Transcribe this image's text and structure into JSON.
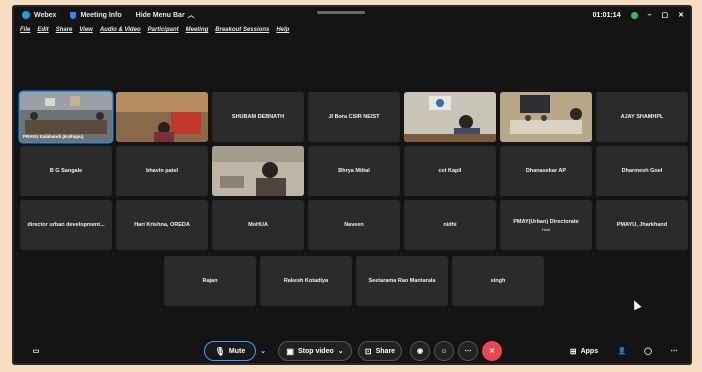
{
  "titlebar": {
    "app_name": "Webex",
    "meeting_info": "Meeting Info",
    "hide_menu_bar": "Hide Menu Bar",
    "timer": "01:01:14"
  },
  "menu": [
    "File",
    "Edit",
    "Share",
    "View",
    "Audio & Video",
    "Participant",
    "Meeting",
    "Breakout Sessions",
    "Help"
  ],
  "participants_row1": [
    {
      "name": "PRAVU Kalahandi (Kolhapu)",
      "video": true,
      "active": true
    },
    {
      "name": "",
      "video": true
    },
    {
      "name": "SHUBAM DEBNATH",
      "video": false
    },
    {
      "name": "JI Bora CSIR NEIST",
      "video": false
    },
    {
      "name": "",
      "video": true
    },
    {
      "name": "",
      "video": true
    },
    {
      "name": "AJAY SHAMHPL",
      "video": false
    }
  ],
  "participants_row2": [
    {
      "name": "B G Sangale",
      "video": false
    },
    {
      "name": "bhavin patel",
      "video": false
    },
    {
      "name": "",
      "video": true
    },
    {
      "name": "Bhrya Mittal",
      "video": false
    },
    {
      "name": "cet Kapil",
      "video": false
    },
    {
      "name": "Dhanasekar AP",
      "video": false
    },
    {
      "name": "Dharmesh Goel",
      "video": false
    }
  ],
  "participants_row3": [
    {
      "name": "director urban development...",
      "sub": "",
      "video": false
    },
    {
      "name": "Hari Krishna, OREDA",
      "sub": "",
      "video": false
    },
    {
      "name": "MoHUA",
      "sub": "",
      "video": false
    },
    {
      "name": "Naveen",
      "sub": "",
      "video": false
    },
    {
      "name": "nidhi",
      "sub": "",
      "video": false
    },
    {
      "name": "PMAY(Urban) Directorate",
      "sub": "Host",
      "video": false
    },
    {
      "name": "PMAYU, Jharkhand",
      "sub": "",
      "video": false
    }
  ],
  "participants_row4": [
    {
      "name": "Rajan",
      "video": false
    },
    {
      "name": "Rakesh Kotadiya",
      "video": false
    },
    {
      "name": "Seetarama Rao Mantarala",
      "video": false
    },
    {
      "name": "singh",
      "video": false
    }
  ],
  "controls": {
    "mute_label": "Mute",
    "video_label": "Stop video",
    "share_label": "Share",
    "apps_label": "Apps"
  },
  "colors": {
    "accent": "#1f8ef1",
    "leave": "#e5484d",
    "tile": "#2b2b2b",
    "background": "#141414"
  }
}
